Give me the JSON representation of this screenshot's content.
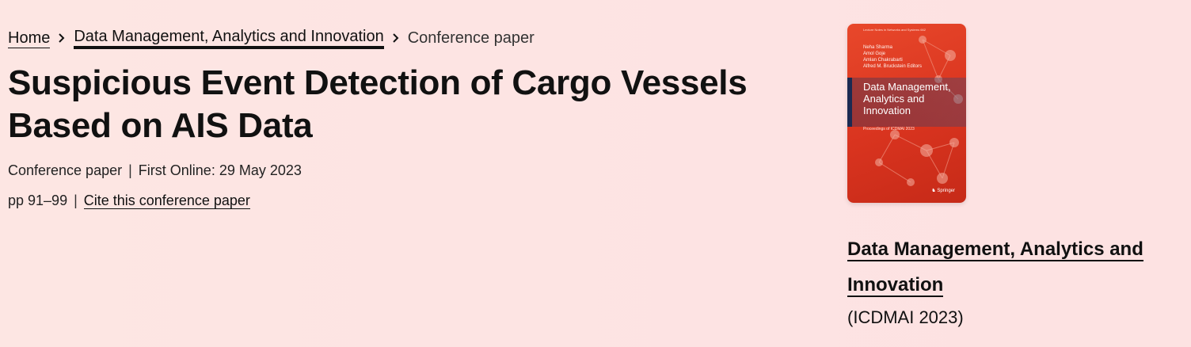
{
  "breadcrumb": {
    "home": "Home",
    "book": "Data Management, Analytics and Innovation",
    "current": "Conference paper"
  },
  "article": {
    "title": "Suspicious Event Detection of Cargo Vessels Based on AIS Data",
    "type": "Conference paper",
    "first_online": "First Online: 29 May 2023",
    "pages": "pp 91–99",
    "cite_label": "Cite this conference paper"
  },
  "book": {
    "cover": {
      "series": "Lecture Notes in Networks and Systems 662",
      "editors": [
        "Neha Sharma",
        "Amol Goje",
        "Amlan Chakrabarti",
        "Alfred M. Bruckstein Editors"
      ],
      "title": "Data Management, Analytics and Innovation",
      "subtitle": "Proceedings of ICDMAI 2023",
      "publisher": "Springer"
    },
    "title": "Data Management, Analytics and Innovation",
    "conference": "(ICDMAI 2023)"
  },
  "colors": {
    "background": "#fde4e2",
    "cover_red": "#d9341f",
    "text": "#111111"
  },
  "icons": {
    "breadcrumb_separator": "chevron-right-icon"
  }
}
